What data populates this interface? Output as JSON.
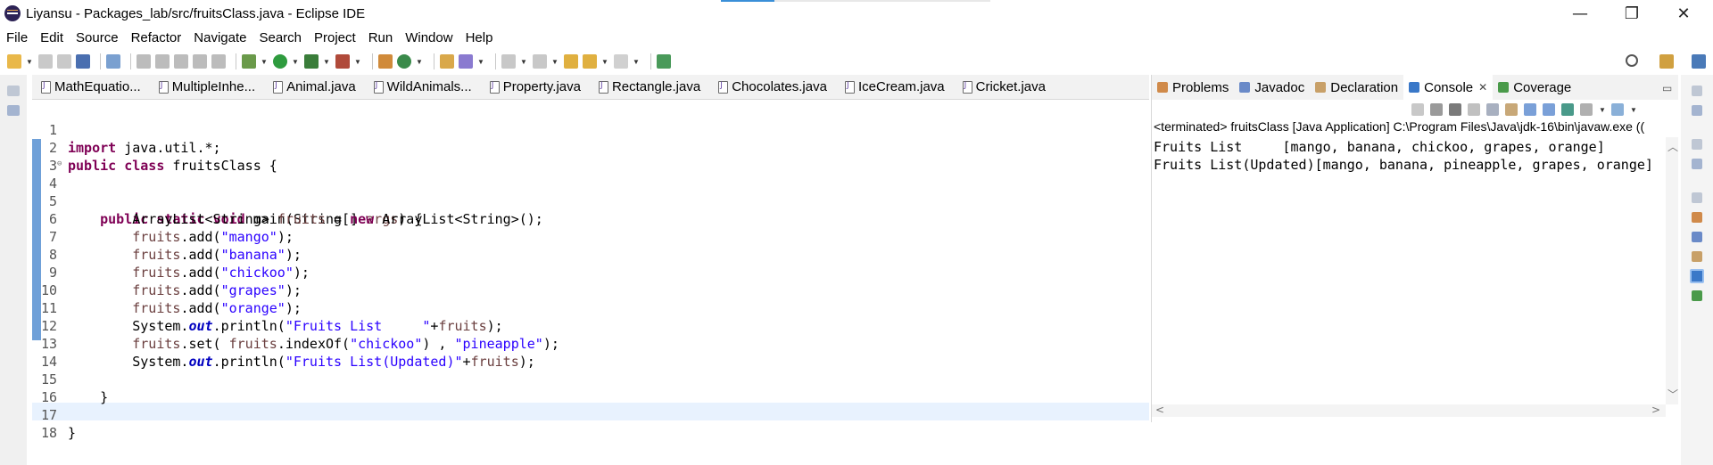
{
  "window": {
    "title": "Liyansu - Packages_lab/src/fruitsClass.java - Eclipse IDE",
    "minimize_glyph": "—",
    "restore_glyph": "❐",
    "close_glyph": "✕"
  },
  "menu": [
    "File",
    "Edit",
    "Source",
    "Refactor",
    "Navigate",
    "Search",
    "Project",
    "Run",
    "Window",
    "Help"
  ],
  "editor": {
    "tabs": [
      "MathEquatio...",
      "MultipleInhe...",
      "Animal.java",
      "WildAnimals...",
      "Property.java",
      "Rectangle.java",
      "Chocolates.java",
      "IceCream.java",
      "Cricket.java"
    ],
    "line_numbers": [
      "1",
      "2",
      "3",
      "4",
      "5",
      "6",
      "7",
      "8",
      "9",
      "10",
      "11",
      "12",
      "13",
      "14",
      "15",
      "16",
      "17",
      "18"
    ],
    "fold_marker": "⊖",
    "code": {
      "l1_kw": "import",
      "l1_rest": " java.util.*;",
      "l2_kw1": "public",
      "l2_kw2": "class",
      "l2_rest": " fruitsClass {",
      "l4_kw1": "public",
      "l4_kw2": "static",
      "l4_kw3": "void",
      "l4_mid": " main(String[] ",
      "l4_var": "args",
      "l4_end": ") {",
      "l5_a": "ArrayList<String> ",
      "l5_var": "fruits",
      "l5_b": " = ",
      "l5_kw": "new",
      "l5_c": " ArrayList<String>();",
      "add_var": "fruits",
      "add_call": ".add(",
      "add_end": ");",
      "items": [
        "\"mango\"",
        "\"banana\"",
        "\"chickoo\"",
        "\"grapes\"",
        "\"orange\""
      ],
      "sys": "System.",
      "out": "out",
      "println": ".println(",
      "l11_str": "\"Fruits List     \"",
      "plus_fruits": "+",
      "l11_end": ");",
      "l12_a": ".set( ",
      "l12_b": ".indexOf(",
      "l12_str1": "\"chickoo\"",
      "l12_c": ") , ",
      "l12_str2": "\"pineapple\"",
      "l12_end": ");",
      "l13_str": "\"Fruits List(Updated)\"",
      "close_brace": "}"
    }
  },
  "console": {
    "tabs": [
      {
        "label": "Problems",
        "icon": "problems-icon"
      },
      {
        "label": "Javadoc",
        "icon": "javadoc-icon"
      },
      {
        "label": "Declaration",
        "icon": "declaration-icon"
      },
      {
        "label": "Console",
        "icon": "console-icon",
        "active": true
      },
      {
        "label": "Coverage",
        "icon": "coverage-icon"
      }
    ],
    "close_glyph": "✕",
    "info": "<terminated> fruitsClass [Java Application] C:\\Program Files\\Java\\jdk-16\\bin\\javaw.exe  ((",
    "output": [
      "Fruits List     [mango, banana, chickoo, grapes, orange]",
      "Fruits List(Updated)[mango, banana, pineapple, grapes, orange]"
    ]
  },
  "colors": {
    "keyword": "#7f0055",
    "string": "#2a00ff",
    "field": "#0000c0",
    "local_var": "#6a3e3e",
    "change_bar": "#6fa0d8",
    "current_line": "#e8f2fe"
  }
}
